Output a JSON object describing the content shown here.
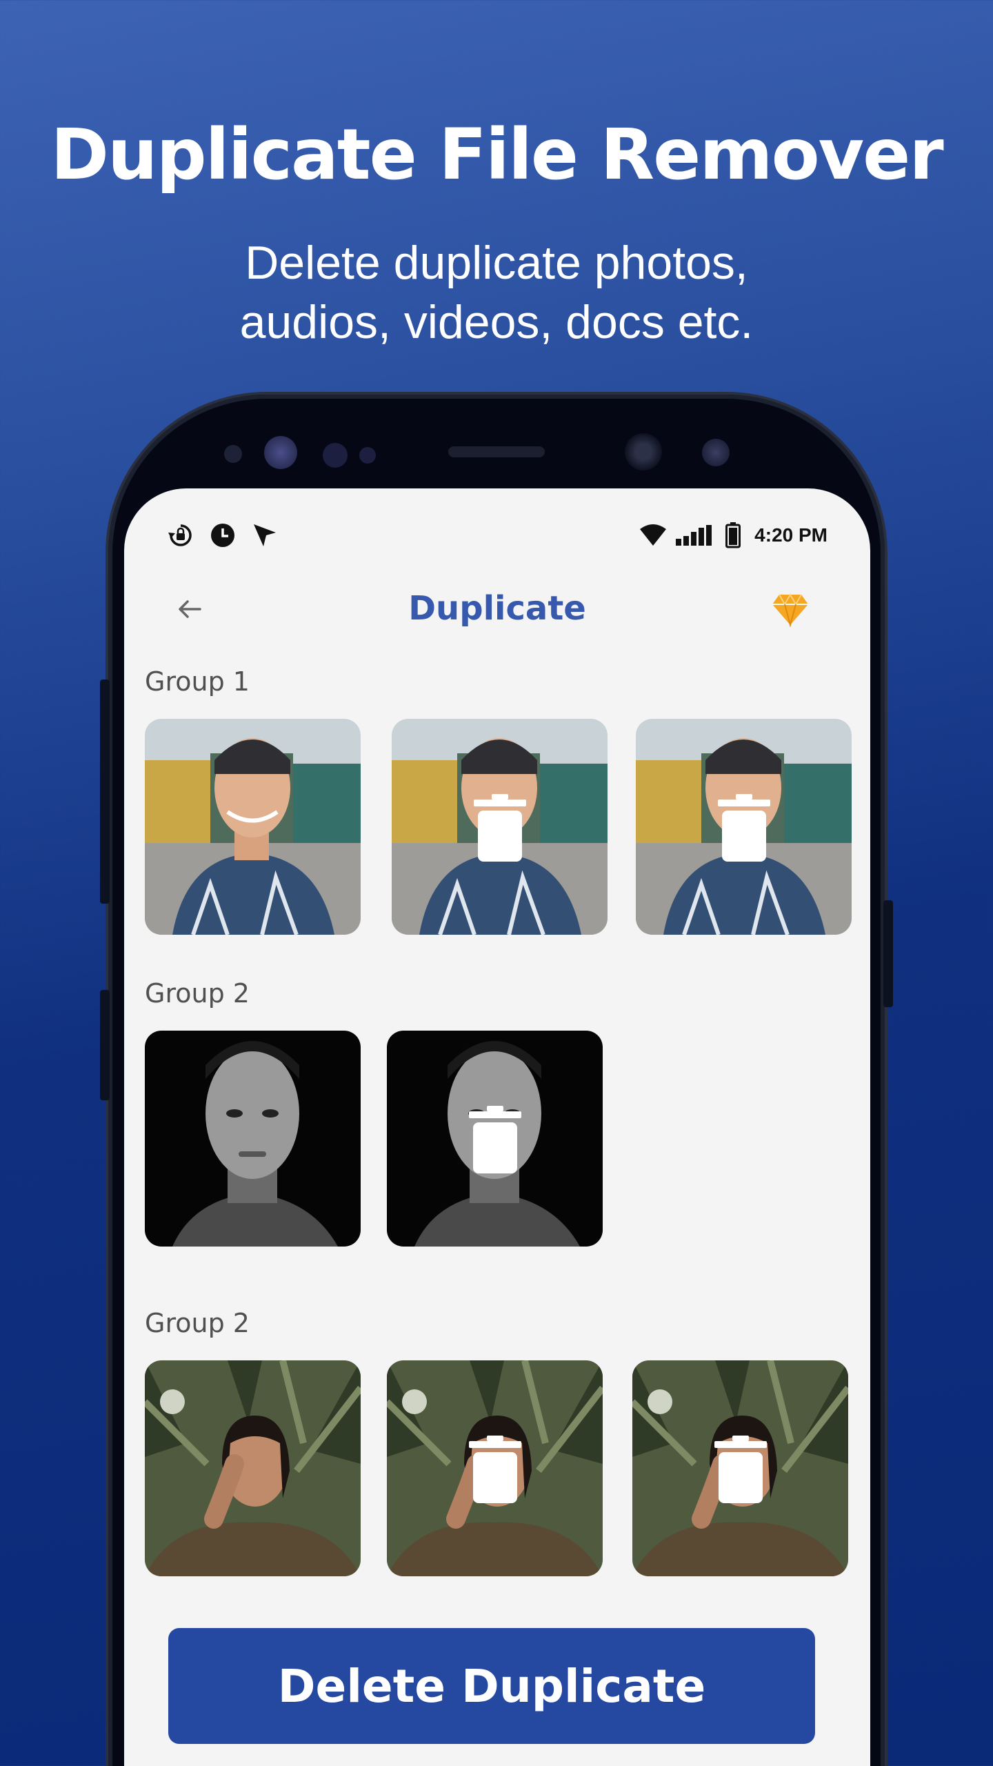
{
  "promo": {
    "title": "Duplicate File Remover",
    "subtitle_line1": "Delete duplicate photos,",
    "subtitle_line2": "audios, videos, docs etc."
  },
  "status_bar": {
    "time": "4:20 PM",
    "left_icons": [
      "screen-rotation-icon",
      "clock-icon",
      "location-arrow-icon"
    ],
    "right_icons": [
      "wifi-icon",
      "signal-icon",
      "battery-icon"
    ]
  },
  "app_bar": {
    "title": "Duplicate",
    "back_icon": "arrow-left-icon",
    "premium_icon": "diamond-icon"
  },
  "groups": [
    {
      "label": "Group 1",
      "items": [
        {
          "photo": "young man with cap, patterned shirt",
          "marked_delete": false
        },
        {
          "photo": "young man with cap, patterned shirt",
          "marked_delete": true
        },
        {
          "photo": "young man with cap, patterned shirt",
          "marked_delete": true
        }
      ]
    },
    {
      "label": "Group 2",
      "items": [
        {
          "photo": "black and white portrait, turtleneck",
          "marked_delete": false
        },
        {
          "photo": "black and white portrait, turtleneck",
          "marked_delete": true
        }
      ]
    },
    {
      "label": "Group 2",
      "items": [
        {
          "photo": "woman among palm leaves",
          "marked_delete": false
        },
        {
          "photo": "woman among palm leaves",
          "marked_delete": true
        },
        {
          "photo": "woman among palm leaves",
          "marked_delete": true
        }
      ]
    }
  ],
  "actions": {
    "delete_label": "Delete Duplicate"
  },
  "colors": {
    "accent": "#3659ad",
    "button": "#2548a0",
    "premium": "#f5a623",
    "screen_bg": "#f4f4f4"
  }
}
